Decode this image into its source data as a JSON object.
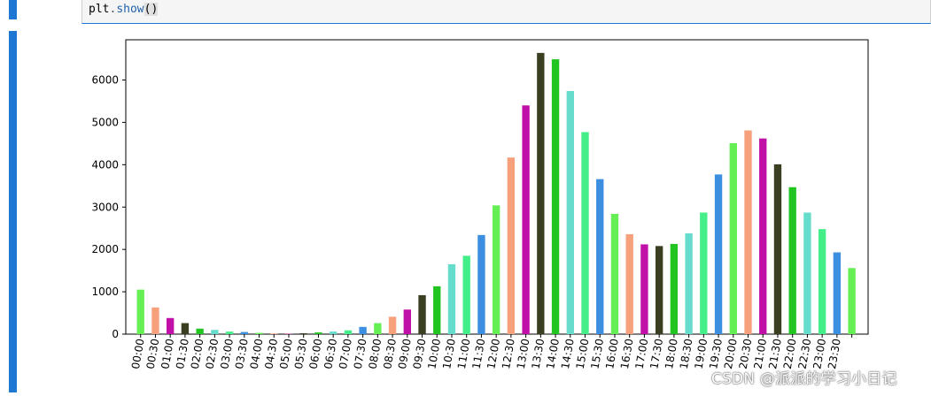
{
  "code": {
    "object": "plt",
    "method": "show",
    "parens": "()"
  },
  "colors": {
    "cell_indicator": "#1e77d3",
    "palette": [
      "#66ee55",
      "#f6a07c",
      "#c010a8",
      "#3a3f22",
      "#22c422",
      "#66dccc",
      "#44ee88",
      "#3c8fe0"
    ]
  },
  "chart_data": {
    "type": "bar",
    "categories": [
      "00:00",
      "00:30",
      "01:00",
      "01:30",
      "02:00",
      "02:30",
      "03:00",
      "03:30",
      "04:00",
      "04:30",
      "05:00",
      "05:30",
      "06:00",
      "06:30",
      "07:00",
      "07:30",
      "08:00",
      "08:30",
      "09:00",
      "09:30",
      "10:00",
      "10:30",
      "11:00",
      "11:30",
      "12:00",
      "12:30",
      "13:00",
      "13:30",
      "14:00",
      "14:30",
      "15:00",
      "15:30",
      "16:00",
      "16:30",
      "17:00",
      "17:30",
      "18:00",
      "18:30",
      "19:00",
      "19:30",
      "20:00",
      "20:30",
      "21:00",
      "21:30",
      "22:00",
      "22:30",
      "23:00",
      "23:30"
    ],
    "values": [
      1050,
      630,
      380,
      260,
      130,
      100,
      60,
      50,
      30,
      15,
      10,
      20,
      40,
      60,
      90,
      170,
      260,
      410,
      580,
      920,
      1130,
      1650,
      1850,
      2340,
      3040,
      4170,
      5400,
      6640,
      6490,
      5740,
      4770,
      3660,
      2840,
      2360,
      2120,
      2080,
      2130,
      2380,
      2870,
      3770,
      4510,
      4810,
      4620,
      4010,
      3470,
      2870,
      2480,
      1930,
      1560
    ],
    "colors": [
      "#66ee55",
      "#f6a07c",
      "#c010a8",
      "#3a3f22",
      "#22c422",
      "#66dccc",
      "#44ee88",
      "#3c8fe0",
      "#66ee55",
      "#f6a07c",
      "#c010a8",
      "#3a3f22",
      "#22c422",
      "#66dccc",
      "#44ee88",
      "#3c8fe0",
      "#66ee55",
      "#f6a07c",
      "#c010a8",
      "#3a3f22",
      "#22c422",
      "#66dccc",
      "#44ee88",
      "#3c8fe0",
      "#66ee55",
      "#f6a07c",
      "#c010a8",
      "#3a3f22",
      "#22c422",
      "#66dccc",
      "#44ee88",
      "#3c8fe0",
      "#66ee55",
      "#f6a07c",
      "#c010a8",
      "#3a3f22",
      "#22c422",
      "#66dccc",
      "#44ee88",
      "#3c8fe0",
      "#66ee55",
      "#f6a07c",
      "#c010a8",
      "#3a3f22",
      "#22c422",
      "#66dccc",
      "#44ee88",
      "#3c8fe0"
    ],
    "yticks": [
      0,
      1000,
      2000,
      3000,
      4000,
      5000,
      6000
    ],
    "ylim": [
      0,
      6950
    ],
    "title": "",
    "xlabel": "",
    "ylabel": "",
    "grid": false
  },
  "watermark": "CSDN @派派的学习小日记"
}
